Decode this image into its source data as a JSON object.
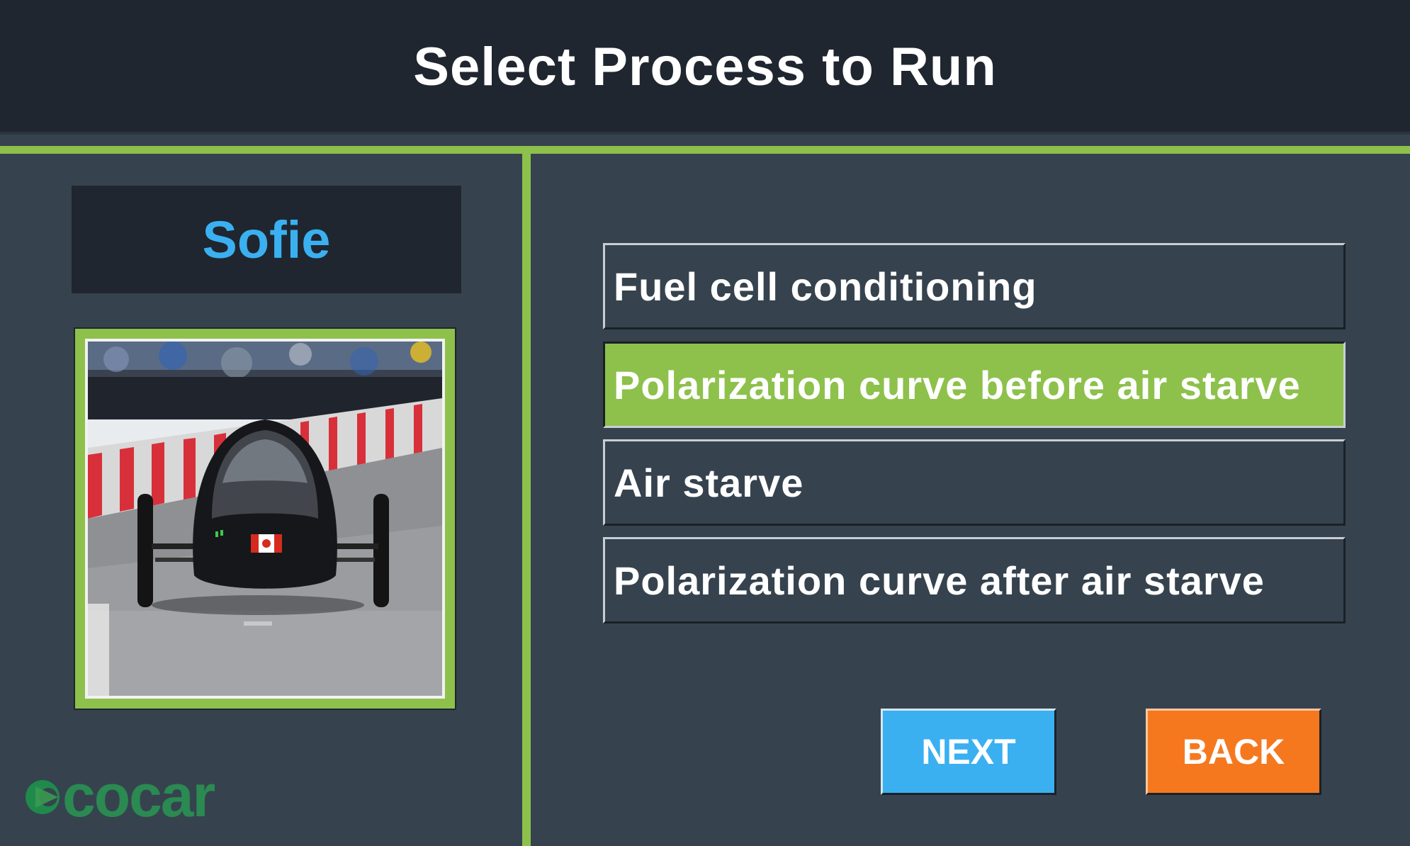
{
  "header": {
    "title": "Select Process to Run"
  },
  "user": {
    "name": "Sofie",
    "photo_icon": "racing-car-photo"
  },
  "logo": {
    "text": "ecocar",
    "color": "#2e8b57"
  },
  "options": [
    {
      "label": "Fuel cell conditioning",
      "selected": false
    },
    {
      "label": "Polarization curve before air starve",
      "selected": true
    },
    {
      "label": "Air starve",
      "selected": false
    },
    {
      "label": "Polarization curve after air starve",
      "selected": false
    }
  ],
  "buttons": {
    "next_label": "NEXT",
    "back_label": "BACK"
  },
  "colors": {
    "accent_green": "#8dc14b",
    "name_blue": "#3ab0f1",
    "next_blue": "#3ab0f1",
    "back_orange": "#f6781e",
    "header_bg": "#1f262f",
    "panel_bg": "#36434e"
  }
}
